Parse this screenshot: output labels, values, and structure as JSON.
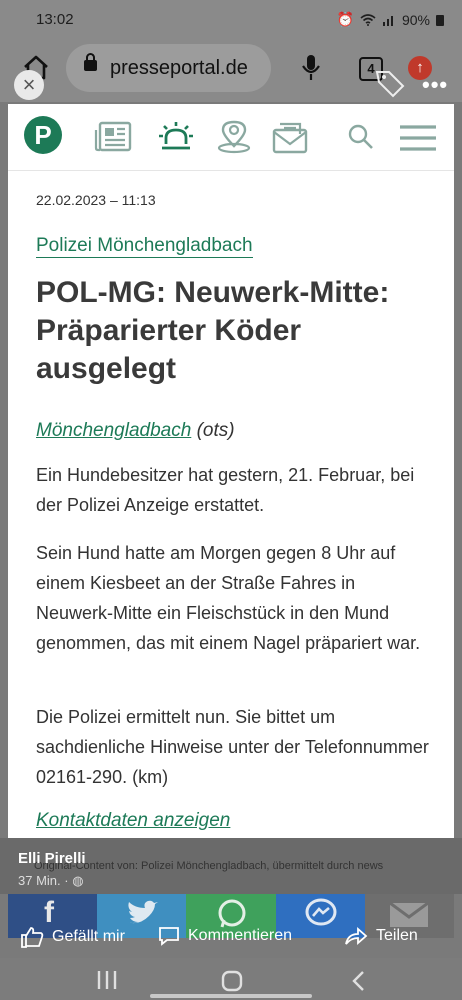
{
  "status": {
    "time": "13:02",
    "battery": "90%"
  },
  "browser": {
    "url": "presseportal.de",
    "tab_count": "4",
    "close_label": "×"
  },
  "article": {
    "date": "22.02.2023 – 11:13",
    "category": "Polizei Mönchengladbach",
    "headline": "POL-MG: Neuwerk-Mitte: Präparierter Köder ausgelegt",
    "place": "Mönchengladbach",
    "source": " (ots)",
    "paragraphs": [
      "Ein Hundebesitzer hat gestern, 21. Februar, bei der Polizei Anzeige erstattet.",
      "Sein Hund hatte am Morgen gegen 8 Uhr auf einem Kiesbeet an der Straße Fahres in Neuwerk-Mitte ein Fleischstück in den Mund genommen, das mit einem Nagel präpariert war.",
      "Die Polizei ermittelt nun. Sie bittet um sachdienliche Hinweise unter der Telefonnummer 02161-290. (km)"
    ],
    "contact_link": "Kontaktdaten anzeigen"
  },
  "post": {
    "author": "Elli Pirelli",
    "time": "37 Min. ·",
    "original": "Original-Content von: Polizei Mönchengladbach, übermittelt durch news",
    "like": "Gefällt mir",
    "comment": "Kommentieren",
    "share": "Teilen"
  },
  "colors": {
    "brand_green": "#1d7a57",
    "facebook": "#3b5998",
    "twitter": "#1da1f2",
    "whatsapp": "#25d366",
    "messenger": "#0084ff",
    "mail": "#888888"
  }
}
